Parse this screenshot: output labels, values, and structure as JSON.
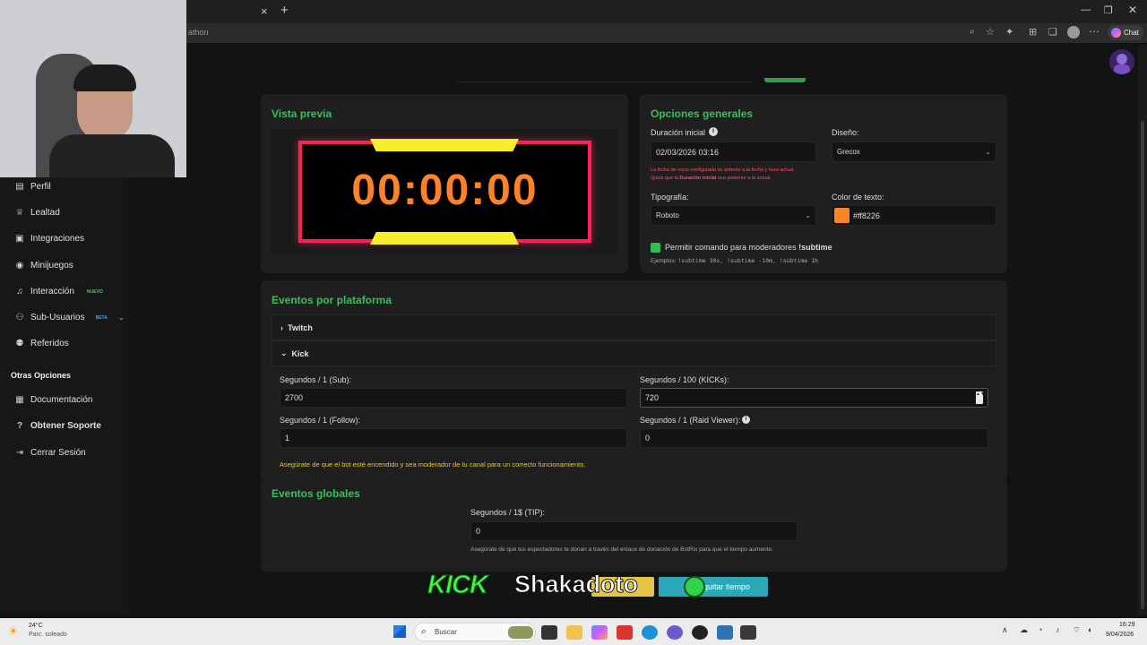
{
  "browser": {
    "tab_close": "×",
    "tab_new": "+",
    "url_fragment": "athon",
    "chat_label": "Chat"
  },
  "sidebar": {
    "items": [
      {
        "label": "Perfil",
        "icon": "id-card-icon"
      },
      {
        "label": "Lealtad",
        "icon": "trophy-icon"
      },
      {
        "label": "Integraciones",
        "icon": "plug-icon"
      },
      {
        "label": "Minijuegos",
        "icon": "gamepad-icon"
      },
      {
        "label": "Interacción",
        "icon": "music-icon",
        "badge": "NUEVO"
      },
      {
        "label": "Sub-Usuarios",
        "icon": "users-icon",
        "badge": "BETA"
      },
      {
        "label": "Referidos",
        "icon": "people-icon"
      }
    ],
    "section_title": "Otras Opciones",
    "other_items": [
      {
        "label": "Documentación",
        "icon": "doc-icon"
      },
      {
        "label": "Obtener Soporte",
        "icon": "help-icon"
      },
      {
        "label": "Cerrar Sesión",
        "icon": "logout-icon"
      }
    ]
  },
  "preview": {
    "title": "Vista previa",
    "timer": "00:00:00",
    "colors": {
      "frame": "#ff1f5a",
      "bar": "#f6ef2a",
      "digits": "#ff8226"
    }
  },
  "general": {
    "title": "Opciones generales",
    "duration_label": "Duración inicial",
    "duration_value": "02/03/2026 03:16",
    "warning_line1": "La fecha de inicio configurada es anterior a la fecha y hora actual.",
    "warning_line2_a": "Quizá que la ",
    "warning_line2_b": "Duración inicial",
    "warning_line2_c": " sea posterior a la actual.",
    "design_label": "Diseño:",
    "design_value": "Grecox",
    "font_label": "Tipografía:",
    "font_value": "Roboto",
    "color_label": "Color de texto:",
    "color_value": "#ff8226",
    "mod_label": "Permitir comando para moderadores",
    "mod_command": "!subtime",
    "examples_label": "Ejemplos:",
    "examples": "!subtime 30s, !subtime -10m, !subtime 1h"
  },
  "platform": {
    "title": "Eventos por plataforma",
    "twitch": "Twitch",
    "kick": "Kick",
    "sub_label": "Segundos / 1 (Sub):",
    "sub_value": "2700",
    "kicks_label": "Segundos / 100 (KICKs):",
    "kicks_value": "720",
    "follow_label": "Segundos / 1 (Follow):",
    "follow_value": "1",
    "raid_label": "Segundos / 1 (Raid Viewer):",
    "raid_value": "0",
    "note": "Asegúrate de que el bot esté encendido y sea moderador de tu canal para un correcto funcionamiento."
  },
  "global": {
    "title": "Eventos globales",
    "tip_label": "Segundos / 1$ (TIP):",
    "tip_value": "0",
    "note": "Asegúrate de que tus espectadores te donan a través del enlace de donación de BotRix para que el tiempo aumente."
  },
  "footer_button": "quitar tiempo",
  "overlay": {
    "kick": "KICK",
    "name": "Shakadoto"
  },
  "taskbar": {
    "temp": "24°C",
    "weather": "Parc. soleado",
    "search": "Buscar",
    "time": "16:29",
    "date": "9/04/2026"
  }
}
